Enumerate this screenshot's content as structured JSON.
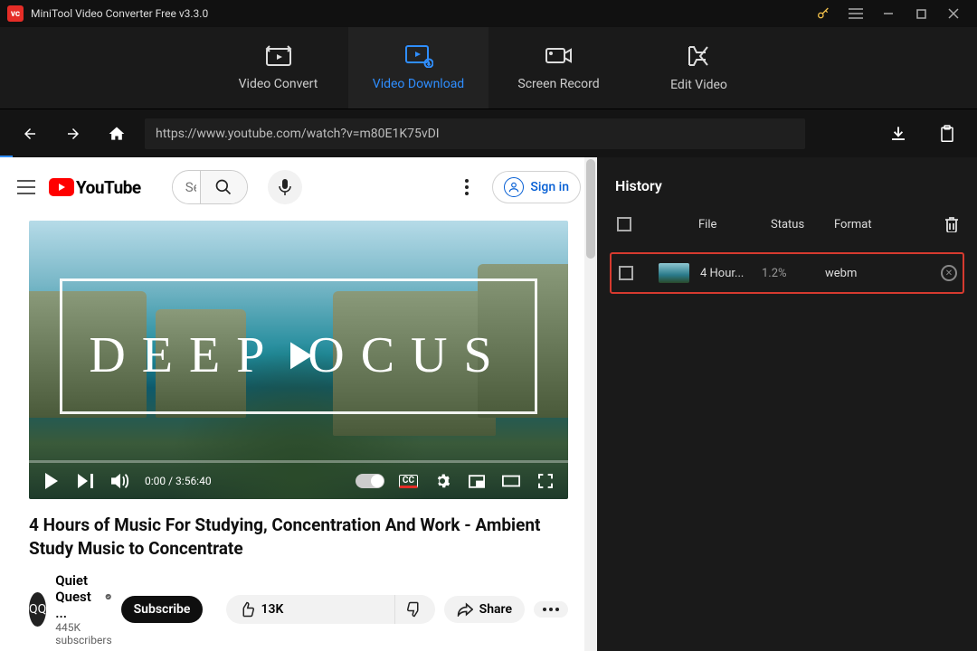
{
  "titlebar": {
    "app_name": "MiniTool Video Converter Free v3.3.0"
  },
  "tabs": {
    "convert": "Video Convert",
    "download": "Video Download",
    "record": "Screen Record",
    "edit": "Edit Video"
  },
  "nav": {
    "url": "https://www.youtube.com/watch?v=m80E1K75vDI"
  },
  "yt": {
    "brand": "YouTube",
    "search_placeholder": "Search",
    "search_value": "Sea",
    "signin": "Sign in",
    "video_overlay_text": "DEEP   OCUS",
    "time": "0:00 / 3:56:40",
    "cc": "CC",
    "title": "4 Hours of Music For Studying, Concentration And Work - Ambient Study Music to Concentrate",
    "channel_name": "Quiet Quest ...",
    "subscribers": "445K subscribers",
    "subscribe": "Subscribe",
    "likes": "13K",
    "share": "Share"
  },
  "history": {
    "title": "History",
    "columns": {
      "file": "File",
      "status": "Status",
      "format": "Format"
    },
    "items": [
      {
        "file": "4 Hour...",
        "status": "1.2%",
        "format": "webm"
      }
    ]
  }
}
